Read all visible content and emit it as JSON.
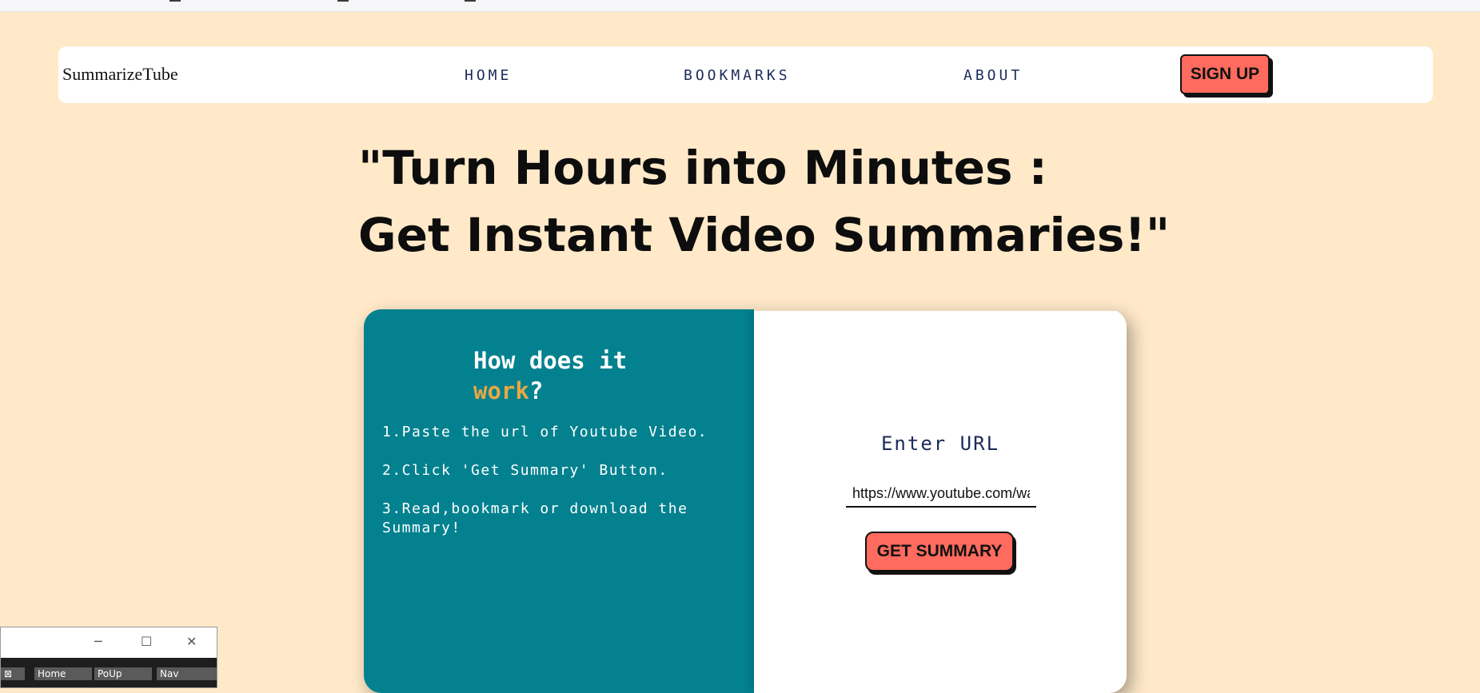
{
  "nav": {
    "brand": "SummarizeTube",
    "links": [
      "HOME",
      "BOOKMARKS",
      "ABOUT"
    ],
    "signup_label": "SIGN UP"
  },
  "hero": {
    "line1": "\"Turn Hours into Minutes :",
    "line2": "Get Instant Video Summaries!\""
  },
  "how_it_works": {
    "title_prefix": "How does it",
    "title_accent": "work",
    "title_suffix": "?",
    "steps": [
      "1.Paste the url of Youtube Video.",
      "2.Click 'Get Summary' Button.",
      "3.Read,bookmark or download the Summary!"
    ]
  },
  "url_form": {
    "label": "Enter URL",
    "input_value": "https://www.youtube.com/watch",
    "submit_label": "GET SUMMARY"
  },
  "taskbar_window": {
    "controls": [
      "─",
      "☐",
      "✕"
    ],
    "tabs": [
      "⊠",
      "Home",
      "PoUp",
      "Nav"
    ]
  },
  "colors": {
    "page_background": "#ffe9c9",
    "accent_button": "#ff6b5e",
    "card_teal": "#03818f",
    "highlight": "#e6a945",
    "nav_text": "#1a2b5a"
  }
}
